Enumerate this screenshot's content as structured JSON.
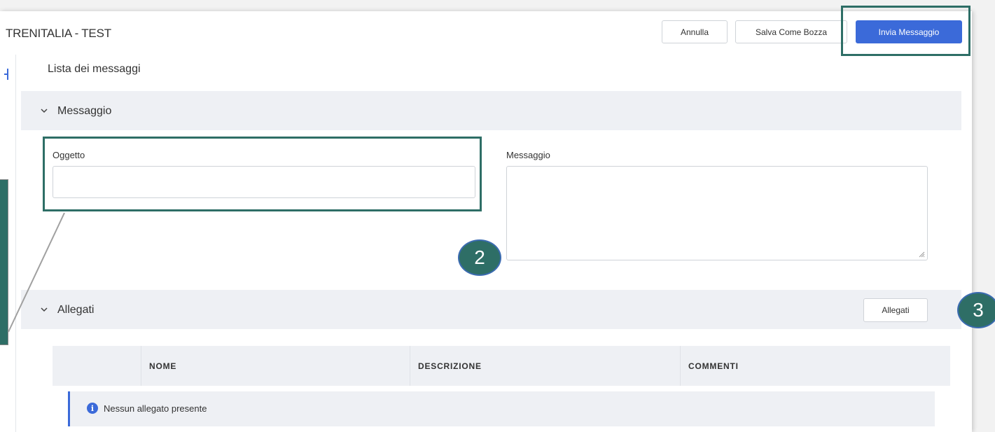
{
  "header": {
    "app_title": "TRENITALIA - TEST",
    "annulla_label": "Annulla",
    "bozza_label": "Salva Come Bozza",
    "invia_label": "Invia Messaggio"
  },
  "breadcrumb": "Lista dei messaggi",
  "sections": {
    "messaggio_title": "Messaggio",
    "allegati_title": "Allegati"
  },
  "form": {
    "oggetto_label": "Oggetto",
    "oggetto_value": "",
    "messaggio_label": "Messaggio",
    "messaggio_value": ""
  },
  "allegati": {
    "button_label": "Allegati",
    "columns": [
      "NOME",
      "DESCRIZIONE",
      "COMMENTI"
    ],
    "empty_message": "Nessun allegato presente"
  },
  "callouts": {
    "two": "2",
    "three": "3"
  },
  "colors": {
    "primary": "#3b6ad9",
    "highlight": "#2e6e66",
    "section_bg": "#eef0f4"
  }
}
